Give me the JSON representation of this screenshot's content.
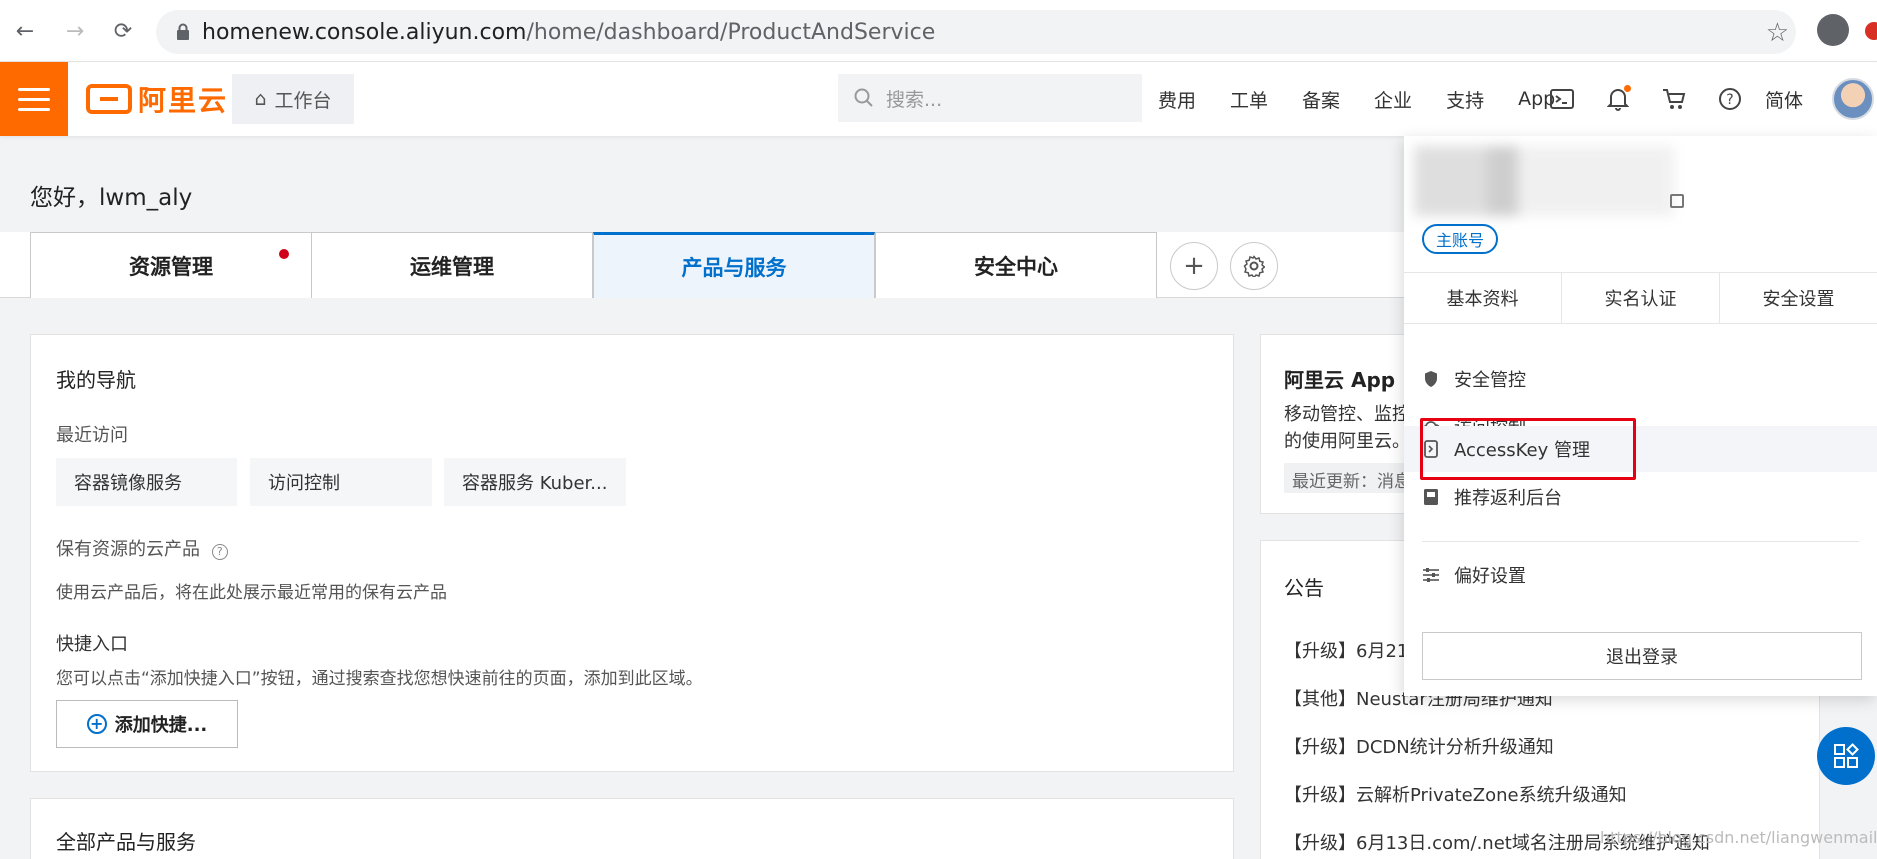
{
  "browser": {
    "url_host": "homenew.console.aliyun.com",
    "url_path": "/home/dashboard/ProductAndService"
  },
  "header": {
    "logo_text": "阿里云",
    "workbench_label": "工作台",
    "search_placeholder": "搜索...",
    "links": [
      "费用",
      "工单",
      "备案",
      "企业",
      "支持",
      "App"
    ],
    "language_label": "简体",
    "brand_color": "#ff6a00"
  },
  "greeting": "您好，lwm_aly",
  "tabs": [
    {
      "label": "资源管理"
    },
    {
      "label": "运维管理"
    },
    {
      "label": "产品与服务"
    },
    {
      "label": "安全中心"
    }
  ],
  "nav_card": {
    "title": "我的导航",
    "recent_label": "最近访问",
    "recent_items": [
      "容器镜像服务",
      "访问控制",
      "容器服务 Kuber..."
    ],
    "owned_label": "保有资源的云产品",
    "owned_desc": "使用云产品后，将在此处展示最近常用的保有云产品",
    "shortcut_label": "快捷入口",
    "shortcut_desc": "您可以点击“添加快捷入口”按钮，通过搜索查找您想快速前往的页面，添加到此区域。",
    "add_button_label": "添加快捷..."
  },
  "all_products": {
    "title": "全部产品与服务"
  },
  "app_card": {
    "title": "阿里云 App",
    "line1": "移动管控、监控",
    "line2": "的使用阿里云。",
    "update_text": "最近更新：消息"
  },
  "notice_card": {
    "title": "公告",
    "items": [
      "【升级】6月21",
      "【其他】Neustar注册局维护通知",
      "【升级】DCDN统计分析升级通知",
      "【升级】云解析PrivateZone系统升级通知",
      "【升级】6月13日.com/.net域名注册局系统维护通知"
    ]
  },
  "dropdown": {
    "account_badge": "主账号",
    "tabs": [
      "基本资料",
      "实名认证",
      "安全设置"
    ],
    "items": [
      {
        "label": "安全管控",
        "icon": "shield-icon"
      },
      {
        "label": "访问控制",
        "icon": "cloud-icon"
      },
      {
        "label": "AccessKey 管理",
        "icon": "key-icon"
      },
      {
        "label": "推荐返利后台",
        "icon": "book-icon"
      },
      {
        "label": "偏好设置",
        "icon": "sliders-icon"
      }
    ],
    "logout_label": "退出登录",
    "highlight_color": "#e60012"
  },
  "watermark": "https://blog.csdn.net/liangwenmail"
}
